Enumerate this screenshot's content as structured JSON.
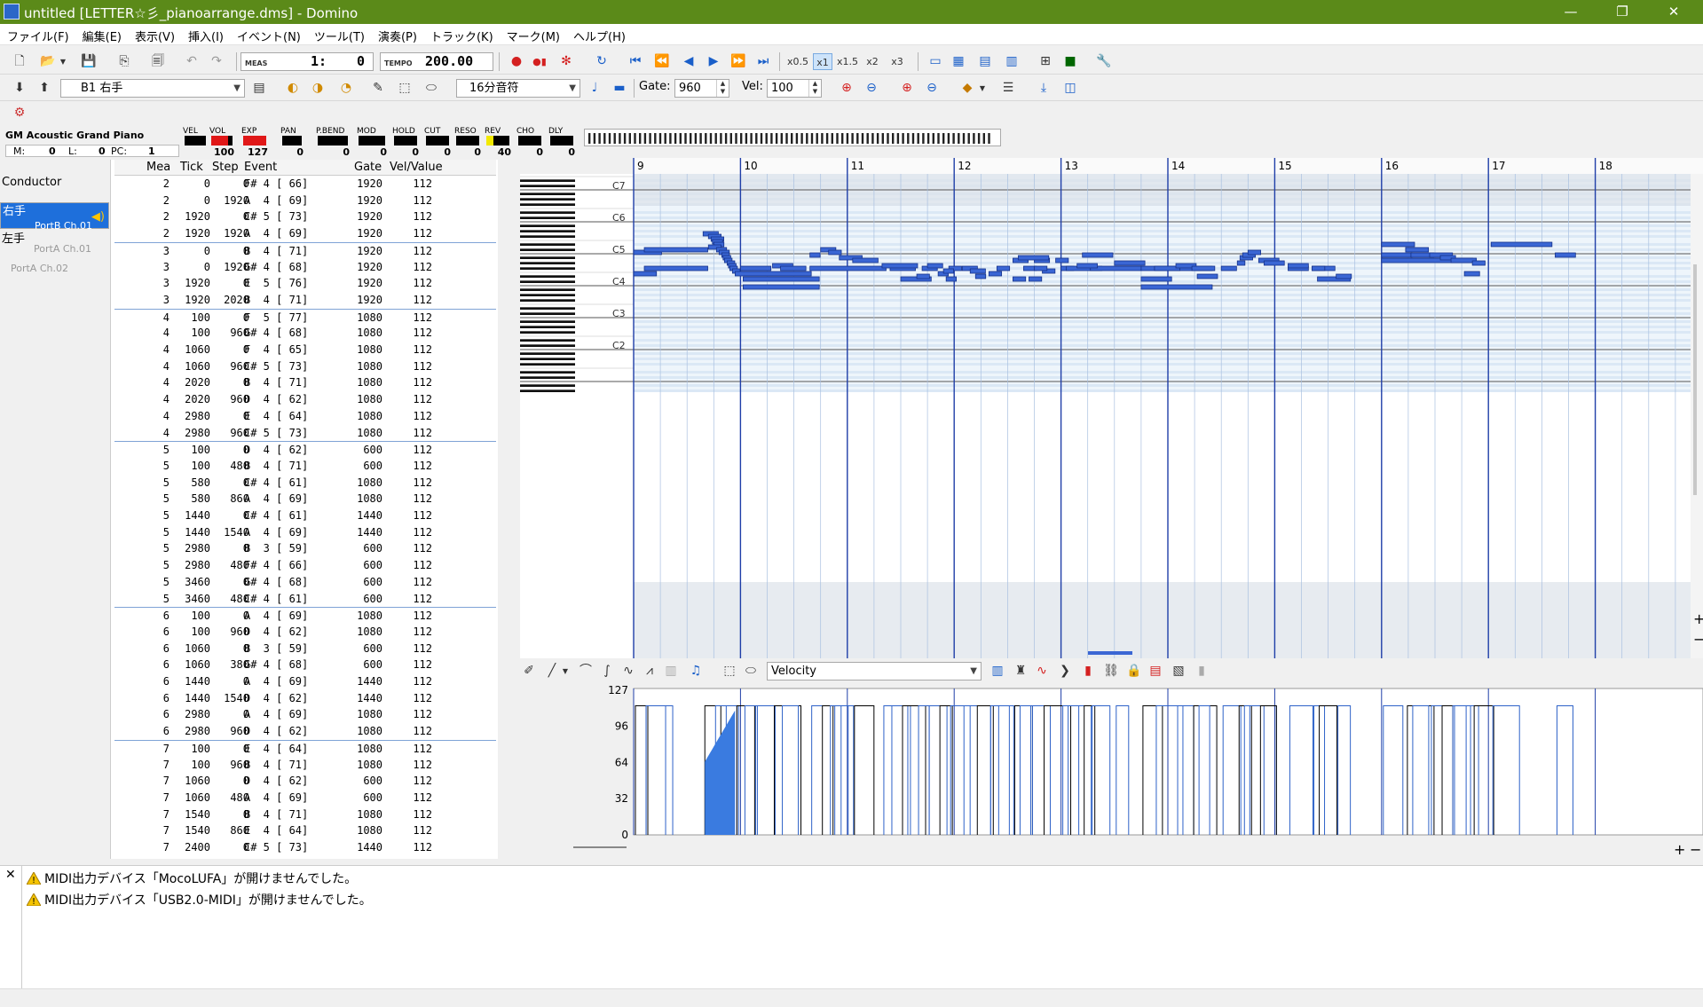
{
  "window": {
    "title": "untitled [LETTER☆彡_pianoarrange.dms] - Domino",
    "min": "—",
    "restore": "❐",
    "close": "✕"
  },
  "menu": [
    "ファイル(F)",
    "編集(E)",
    "表示(V)",
    "挿入(I)",
    "イベント(N)",
    "ツール(T)",
    "演奏(P)",
    "トラック(K)",
    "マーク(M)",
    "ヘルプ(H)"
  ],
  "toolbar1": {
    "meas_label": "MEAS",
    "meas_value": "1:",
    "meas_tick": "0",
    "tempo_label": "TEMPO",
    "tempo_value": "200.00",
    "speeds": [
      "x0.5",
      "x1",
      "x1.5",
      "x2",
      "x3"
    ]
  },
  "toolbar2": {
    "track_select": "B1 右手",
    "note_length": "16分音符",
    "gate_label": "Gate:",
    "gate_value": "960",
    "vel_label": "Vel:",
    "vel_value": "100"
  },
  "channel": {
    "instrument": "GM Acoustic Grand Piano",
    "bank": {
      "m_label": "M:",
      "m": "0",
      "l_label": "L:",
      "l": "0",
      "pc_label": "PC:",
      "pc": "1"
    },
    "meters": [
      {
        "label": "VEL",
        "value": "",
        "level": 0
      },
      {
        "label": "VOL",
        "value": "100",
        "level": 0.79
      },
      {
        "label": "EXP",
        "value": "127",
        "level": 1.0
      },
      {
        "label": "PAN",
        "value": "0",
        "level": 0
      },
      {
        "label": "P.BEND",
        "value": "0",
        "level": 0
      },
      {
        "label": "MOD",
        "value": "0",
        "level": 0
      },
      {
        "label": "HOLD",
        "value": "0",
        "level": 0
      },
      {
        "label": "CUT",
        "value": "0",
        "level": 0
      },
      {
        "label": "RESO",
        "value": "0",
        "level": 0
      },
      {
        "label": "REV",
        "value": "40",
        "level": 0.31
      },
      {
        "label": "CHO",
        "value": "0",
        "level": 0
      },
      {
        "label": "DLY",
        "value": "0",
        "level": 0
      }
    ]
  },
  "tracks": [
    {
      "name": "Conductor",
      "port": ""
    },
    {
      "name": "右手",
      "port": "PortB  Ch.01",
      "selected": true
    },
    {
      "name": "左手",
      "port": "PortA  Ch.01"
    },
    {
      "name": "",
      "port": "PortA  Ch.02"
    }
  ],
  "event_list": {
    "headers": [
      "Mea",
      "Tick",
      "Step",
      "Event",
      "Gate",
      "Vel/Value"
    ],
    "rows": [
      [
        "2",
        "0",
        "0",
        "F# 4 [ 66]",
        "1920",
        "112"
      ],
      [
        "2",
        "0",
        "1920",
        "A  4 [ 69]",
        "1920",
        "112"
      ],
      [
        "2",
        "1920",
        "0",
        "C# 5 [ 73]",
        "1920",
        "112"
      ],
      [
        "2",
        "1920",
        "1920",
        "A  4 [ 69]",
        "1920",
        "112"
      ],
      [
        "3",
        "0",
        "0",
        "B  4 [ 71]",
        "1920",
        "112"
      ],
      [
        "3",
        "0",
        "1920",
        "G# 4 [ 68]",
        "1920",
        "112"
      ],
      [
        "3",
        "1920",
        "0",
        "E  5 [ 76]",
        "1920",
        "112"
      ],
      [
        "3",
        "1920",
        "2020",
        "B  4 [ 71]",
        "1920",
        "112"
      ],
      [
        "4",
        "100",
        "0",
        "F  5 [ 77]",
        "1080",
        "112"
      ],
      [
        "4",
        "100",
        "960",
        "G# 4 [ 68]",
        "1080",
        "112"
      ],
      [
        "4",
        "1060",
        "0",
        "F  4 [ 65]",
        "1080",
        "112"
      ],
      [
        "4",
        "1060",
        "960",
        "C# 5 [ 73]",
        "1080",
        "112"
      ],
      [
        "4",
        "2020",
        "0",
        "B  4 [ 71]",
        "1080",
        "112"
      ],
      [
        "4",
        "2020",
        "960",
        "D  4 [ 62]",
        "1080",
        "112"
      ],
      [
        "4",
        "2980",
        "0",
        "E  4 [ 64]",
        "1080",
        "112"
      ],
      [
        "4",
        "2980",
        "960",
        "C# 5 [ 73]",
        "1080",
        "112"
      ],
      [
        "5",
        "100",
        "0",
        "D  4 [ 62]",
        "600",
        "112"
      ],
      [
        "5",
        "100",
        "480",
        "B  4 [ 71]",
        "600",
        "112"
      ],
      [
        "5",
        "580",
        "0",
        "C# 4 [ 61]",
        "1080",
        "112"
      ],
      [
        "5",
        "580",
        "860",
        "A  4 [ 69]",
        "1080",
        "112"
      ],
      [
        "5",
        "1440",
        "0",
        "C# 4 [ 61]",
        "1440",
        "112"
      ],
      [
        "5",
        "1440",
        "1540",
        "A  4 [ 69]",
        "1440",
        "112"
      ],
      [
        "5",
        "2980",
        "0",
        "B  3 [ 59]",
        "600",
        "112"
      ],
      [
        "5",
        "2980",
        "480",
        "F# 4 [ 66]",
        "600",
        "112"
      ],
      [
        "5",
        "3460",
        "0",
        "G# 4 [ 68]",
        "600",
        "112"
      ],
      [
        "5",
        "3460",
        "480",
        "C# 4 [ 61]",
        "600",
        "112"
      ],
      [
        "6",
        "100",
        "0",
        "A  4 [ 69]",
        "1080",
        "112"
      ],
      [
        "6",
        "100",
        "960",
        "D  4 [ 62]",
        "1080",
        "112"
      ],
      [
        "6",
        "1060",
        "0",
        "B  3 [ 59]",
        "600",
        "112"
      ],
      [
        "6",
        "1060",
        "380",
        "G# 4 [ 68]",
        "600",
        "112"
      ],
      [
        "6",
        "1440",
        "0",
        "A  4 [ 69]",
        "1440",
        "112"
      ],
      [
        "6",
        "1440",
        "1540",
        "D  4 [ 62]",
        "1440",
        "112"
      ],
      [
        "6",
        "2980",
        "0",
        "A  4 [ 69]",
        "1080",
        "112"
      ],
      [
        "6",
        "2980",
        "960",
        "D  4 [ 62]",
        "1080",
        "112"
      ],
      [
        "7",
        "100",
        "0",
        "E  4 [ 64]",
        "1080",
        "112"
      ],
      [
        "7",
        "100",
        "960",
        "B  4 [ 71]",
        "1080",
        "112"
      ],
      [
        "7",
        "1060",
        "0",
        "D  4 [ 62]",
        "600",
        "112"
      ],
      [
        "7",
        "1060",
        "480",
        "A  4 [ 69]",
        "600",
        "112"
      ],
      [
        "7",
        "1540",
        "0",
        "B  4 [ 71]",
        "1080",
        "112"
      ],
      [
        "7",
        "1540",
        "860",
        "E  4 [ 64]",
        "1080",
        "112"
      ],
      [
        "7",
        "2400",
        "0",
        "C# 5 [ 73]",
        "1440",
        "112"
      ]
    ]
  },
  "piano_roll": {
    "measures": [
      "9",
      "10",
      "11",
      "12",
      "13",
      "14",
      "15",
      "16",
      "17",
      "18"
    ],
    "octaves": [
      "C7",
      "C6",
      "C5",
      "C4",
      "C3",
      "C2"
    ]
  },
  "velocity_panel": {
    "mode": "Velocity",
    "axis": [
      "127",
      "96",
      "64",
      "32",
      "0"
    ]
  },
  "messages": [
    "MIDI出力デバイス「MocoLUFA」が開けませんでした。",
    "MIDI出力デバイス「USB2.0-MIDI」が開けませんでした。"
  ]
}
